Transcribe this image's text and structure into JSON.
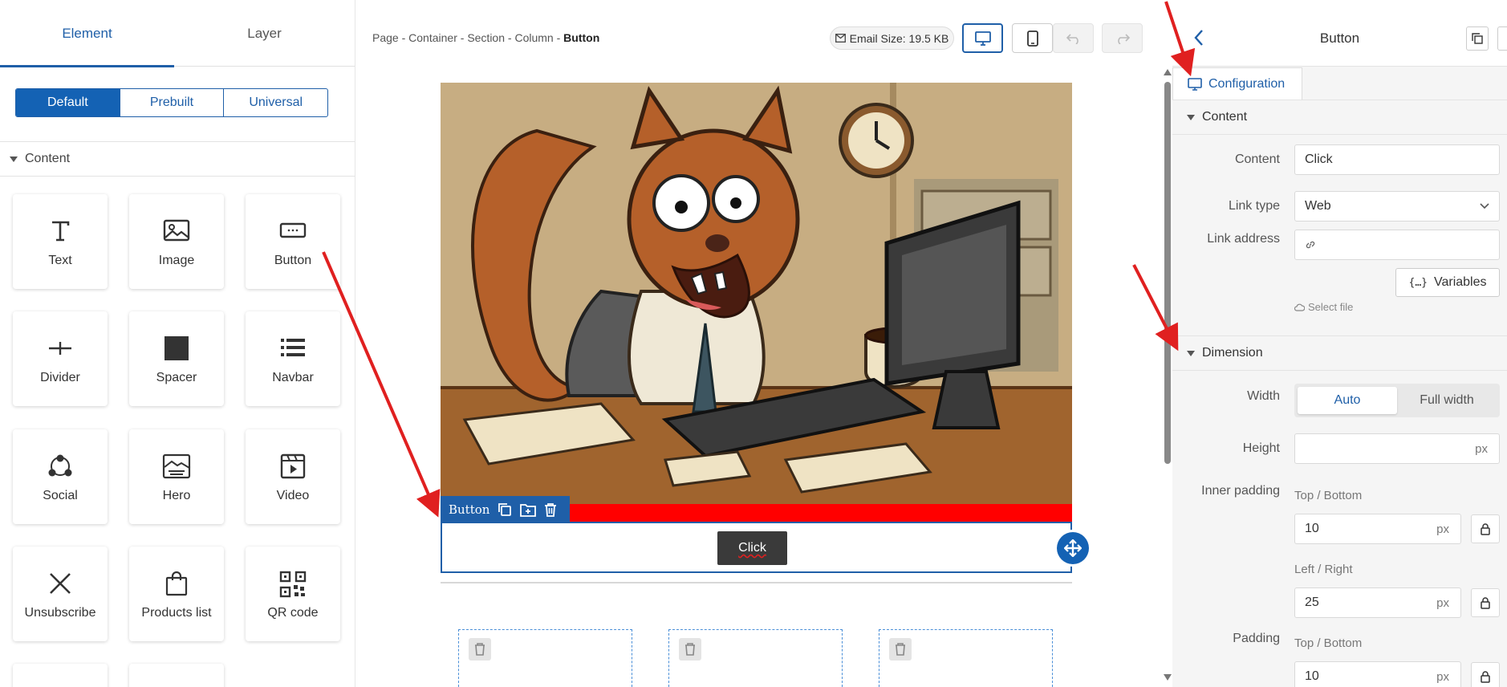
{
  "left_panel": {
    "tabs": [
      "Element",
      "Layer"
    ],
    "segments": [
      "Default",
      "Prebuilt",
      "Universal"
    ],
    "section_title": "Content",
    "tiles": [
      "Text",
      "Image",
      "Button",
      "Divider",
      "Spacer",
      "Navbar",
      "Social",
      "Hero",
      "Video",
      "Unsubscribe",
      "Products list",
      "QR code"
    ]
  },
  "canvas": {
    "breadcrumb": [
      "Page",
      "Container",
      "Section",
      "Column"
    ],
    "breadcrumb_current": "Button",
    "breadcrumb_sep": "-",
    "email_size": "Email Size: 19.5 KB",
    "block_label": "Button",
    "button_text": "Click"
  },
  "right_panel": {
    "title": "Button",
    "tab": "Configuration",
    "content_section": "Content",
    "content_label": "Content",
    "content_value": "Click",
    "link_type_label": "Link type",
    "link_type_value": "Web",
    "link_address_label": "Link address",
    "variables_label": "Variables",
    "select_file_label": "Select file",
    "dimension_section": "Dimension",
    "width_label": "Width",
    "width_options": [
      "Auto",
      "Full width"
    ],
    "width_selected": "Auto",
    "height_label": "Height",
    "unit": "px",
    "inner_padding_label": "Inner padding",
    "top_bottom_label": "Top / Bottom",
    "left_right_label": "Left / Right",
    "inner_top_bottom": "10",
    "inner_left_right": "25",
    "padding_label": "Padding",
    "padding_top_bottom": "10"
  },
  "colors": {
    "accent": "#1f5fa8",
    "highlight_bar": "#ff0000",
    "annotation_arrow": "#e02020"
  }
}
